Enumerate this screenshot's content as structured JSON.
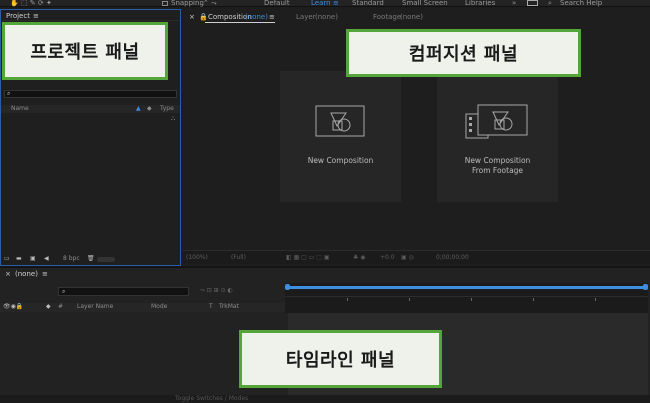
{
  "toolbar": {
    "snapping_label": "Snapping",
    "workspaces": [
      "Default",
      "Learn",
      "Standard",
      "Small Screen",
      "Libraries"
    ],
    "active_workspace": "Learn",
    "search_placeholder": "Search Help"
  },
  "project_panel": {
    "tab_label": "Project",
    "columns": {
      "name": "Name",
      "type": "Type"
    },
    "bpc_label": "8 bpc"
  },
  "composition_panel": {
    "tab_label": "Composition",
    "tab_value": "(none)",
    "layer_label": "Layer",
    "layer_value": "(none)",
    "footage_label": "Footage",
    "footage_value": "(none)",
    "card_new": "New Composition",
    "card_from_footage_line1": "New Composition",
    "card_from_footage_line2": "From Footage",
    "footer": {
      "zoom": "(100%)",
      "resolution": "(Full)",
      "exposure": "+0.0",
      "timecode": "0;00;00;00"
    }
  },
  "timeline_panel": {
    "tab_label": "(none)",
    "columns": {
      "layer_name": "Layer Name",
      "mode": "Mode",
      "t": "T",
      "trkmat": "TrkMat"
    },
    "bottom_label": "Toggle Switches / Modes"
  },
  "annotations": {
    "project": "프로젝트 패널",
    "composition": "컴퍼지션 패널",
    "timeline": "타임라인 패널"
  },
  "colors": {
    "accent": "#3d8ee0",
    "label_border": "#55a63a",
    "label_bg": "#eef2ea",
    "panel_focus": "#2b5ea8"
  }
}
